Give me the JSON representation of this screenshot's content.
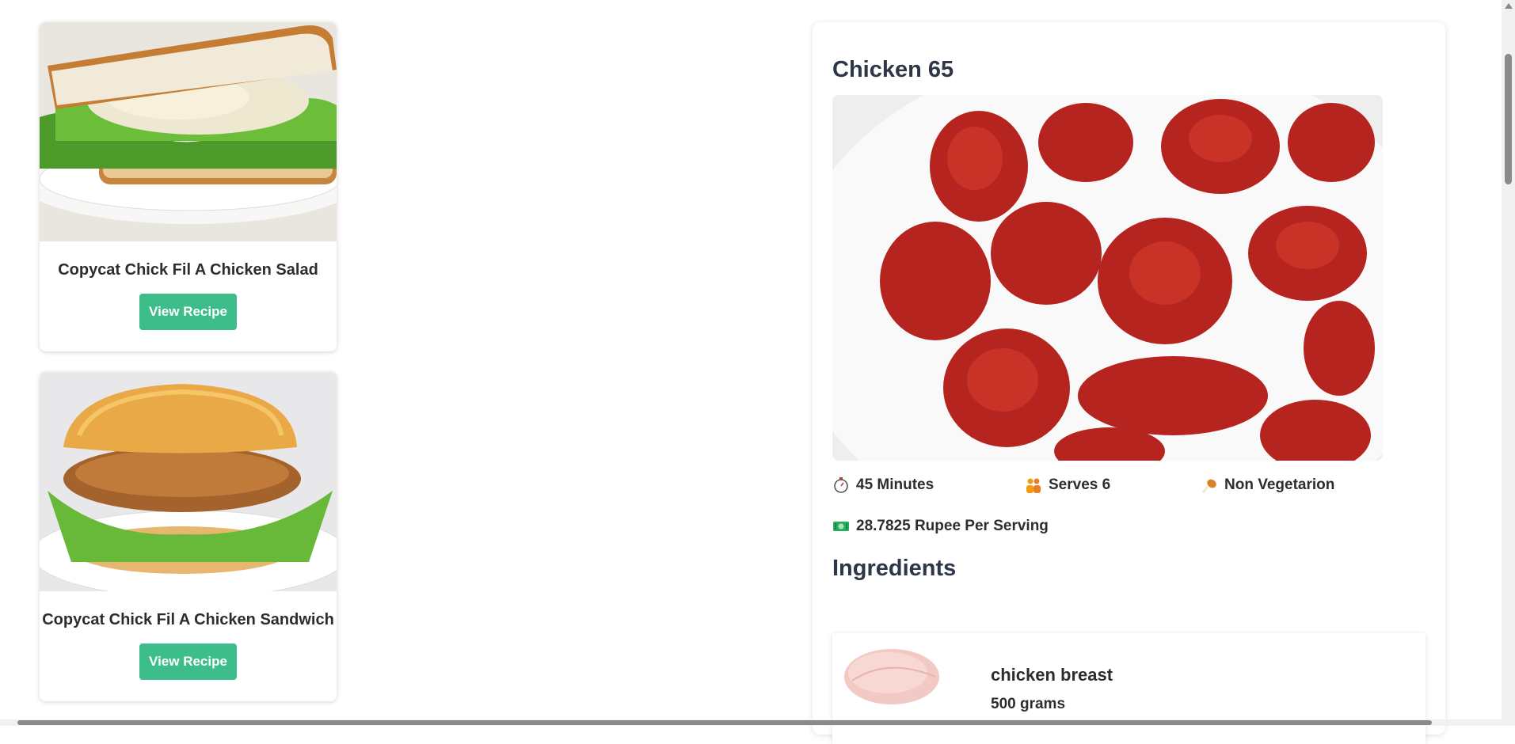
{
  "recipes": [
    {
      "title": "Copycat Chick Fil A Chicken Salad",
      "button": "View Recipe"
    },
    {
      "title": "Copycat Chick Fil A Chicken Sandwich",
      "button": "View Recipe"
    }
  ],
  "detail": {
    "title": "Chicken 65",
    "meta": {
      "time": "45 Minutes",
      "serves": "Serves 6",
      "diet": "Non Vegetarion",
      "cost": "28.7825 Rupee Per Serving"
    },
    "ingredients_heading": "Ingredients",
    "ingredients": [
      {
        "name": "chicken breast",
        "amount": "500 grams"
      }
    ]
  },
  "colors": {
    "button": "#3dbd8a",
    "heading": "#2d3748"
  },
  "icons": [
    "stopwatch-icon",
    "people-icon",
    "drumstick-icon",
    "money-icon"
  ]
}
